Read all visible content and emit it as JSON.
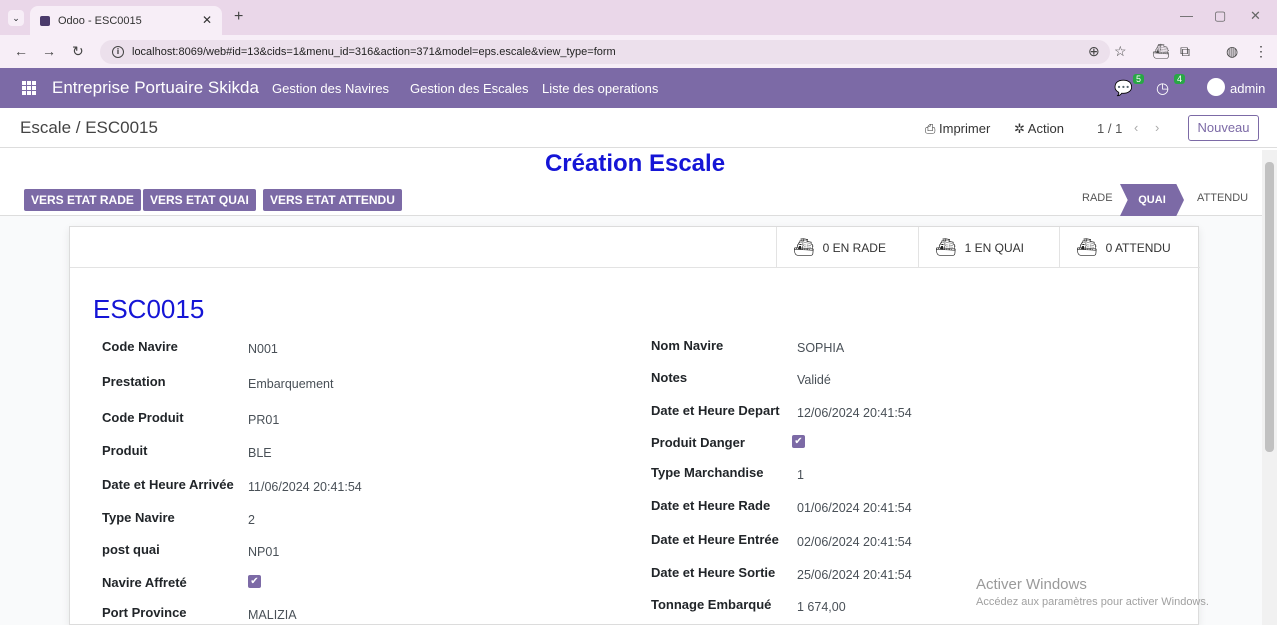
{
  "browser": {
    "tab_title": "Odoo - ESC0015",
    "url": "localhost:8069/web#id=13&cids=1&menu_id=316&action=371&model=eps.escale&view_type=form"
  },
  "navbar": {
    "brand": "Entreprise Portuaire Skikda",
    "menus": [
      "Gestion des Navires",
      "Gestion des Escales",
      "Liste des operations"
    ],
    "messages_count": "5",
    "activities_count": "4",
    "user": "admin"
  },
  "control_panel": {
    "breadcrumb": "Escale / ESC0015",
    "print_label": "Imprimer",
    "action_label": "Action",
    "pager": "1 / 1",
    "new_label": "Nouveau"
  },
  "form": {
    "title": "Création Escale",
    "buttons": [
      "VERS ETAT RADE",
      "VERS ETAT QUAI",
      "VERS ETAT ATTENDU"
    ],
    "stages": [
      "RADE",
      "QUAI",
      "ATTENDU"
    ],
    "active_stage": "QUAI",
    "stat_buttons": [
      "0 EN RADE",
      "1 EN QUAI",
      "0 ATTENDU"
    ],
    "record_name": "ESC0015",
    "left_fields": [
      {
        "label": "Code Navire",
        "value": "N001"
      },
      {
        "label": "Prestation",
        "value": "Embarquement"
      },
      {
        "label": "Code Produit",
        "value": "PR01"
      },
      {
        "label": "Produit",
        "value": "BLE"
      },
      {
        "label": "Date et Heure Arrivée",
        "value": "11/06/2024 20:41:54"
      },
      {
        "label": "Type Navire",
        "value": "2"
      },
      {
        "label": "post quai",
        "value": "NP01"
      },
      {
        "label": "Navire Affreté",
        "value": "✔"
      },
      {
        "label": "Port Province",
        "value": "MALIZIA"
      }
    ],
    "right_fields": [
      {
        "label": "Nom Navire",
        "value": "SOPHIA"
      },
      {
        "label": "Notes",
        "value": "Validé"
      },
      {
        "label": "Date et Heure Depart",
        "value": "12/06/2024 20:41:54"
      },
      {
        "label": "Produit Danger",
        "value": "✔"
      },
      {
        "label": "Type Marchandise",
        "value": "1"
      },
      {
        "label": "Date et Heure Rade",
        "value": "01/06/2024 20:41:54"
      },
      {
        "label": "Date et Heure Entrée",
        "value": "02/06/2024 20:41:54"
      },
      {
        "label": "Date et Heure Sortie",
        "value": "25/06/2024 20:41:54"
      },
      {
        "label": "Tonnage Embarqué",
        "value": "1 674,00"
      }
    ]
  },
  "watermark": {
    "line1": "Activer Windows",
    "line2": "Accédez aux paramètres pour activer Windows."
  }
}
